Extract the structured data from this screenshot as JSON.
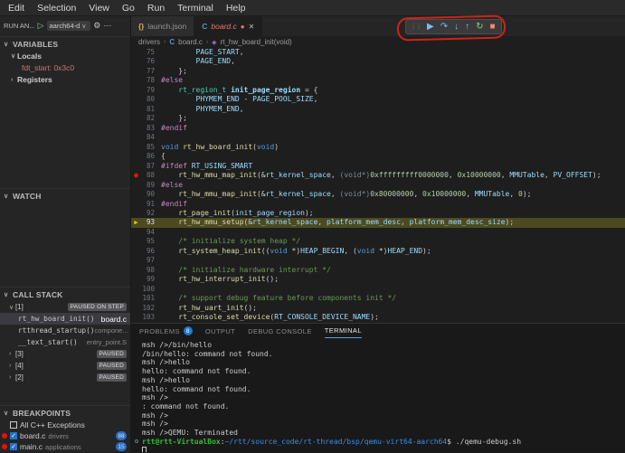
{
  "menu": {
    "items": [
      "Edit",
      "Selection",
      "View",
      "Go",
      "Run",
      "Terminal",
      "Help"
    ]
  },
  "colors": {
    "breakpoint_red": "#e51400",
    "current_line_arrow": "#ffcc00",
    "debug_icon_blue": "#75beff",
    "restart_green": "#89d185",
    "stop_red": "#f48771",
    "annotation_red": "#cc2418",
    "badge_blue": "#2e6fc0",
    "active_tab_file": "#e5796c"
  },
  "sidebar": {
    "run_header": {
      "label": "RUN AN...",
      "config_name": "aarch64-d",
      "chevron": "∨"
    },
    "variables": {
      "title": "VARIABLES",
      "locals_label": "Locals",
      "items": [
        {
          "name": "fdt_start",
          "value": "0x3c0"
        }
      ],
      "registers_label": "Registers"
    },
    "watch": {
      "title": "WATCH"
    },
    "call_stack": {
      "title": "CALL STACK",
      "threads": [
        {
          "label": "[1]",
          "badge": "PAUSED ON STEP",
          "expanded": true,
          "frames": [
            {
              "fn": "rt_hw_board_init()",
              "loc": "board.c",
              "selected": true
            },
            {
              "fn": "rtthread_startup()",
              "loc": "compone...",
              "selected": false
            },
            {
              "fn": "__text_start()",
              "loc": "entry_point.S",
              "selected": false
            }
          ]
        },
        {
          "label": "[3]",
          "badge": "PAUSED",
          "expanded": false,
          "frames": []
        },
        {
          "label": "[4]",
          "badge": "PAUSED",
          "expanded": false,
          "frames": []
        },
        {
          "label": "[2]",
          "badge": "PAUSED",
          "expanded": false,
          "frames": []
        }
      ]
    },
    "breakpoints": {
      "title": "BREAKPOINTS",
      "exceptions_label": "All C++ Exceptions",
      "items": [
        {
          "file": "board.c",
          "path": "drivers",
          "count": "88"
        },
        {
          "file": "main.c",
          "path": "applications",
          "count": "15"
        }
      ]
    }
  },
  "editor_tabs": [
    {
      "label": "launch.json",
      "icon": "braces",
      "active": false,
      "modified": false
    },
    {
      "label": "board.c",
      "icon": "c-file",
      "active": true,
      "modified": true
    }
  ],
  "debug_toolbar": {
    "buttons": [
      {
        "name": "continue-icon",
        "glyph": "▶",
        "color": "#75beff"
      },
      {
        "name": "step-over-icon",
        "glyph": "↷",
        "color": "#75beff"
      },
      {
        "name": "step-into-icon",
        "glyph": "↓",
        "color": "#75beff"
      },
      {
        "name": "step-out-icon",
        "glyph": "↑",
        "color": "#75beff"
      },
      {
        "name": "restart-icon",
        "glyph": "↻",
        "color": "#89d185"
      },
      {
        "name": "stop-icon",
        "glyph": "■",
        "color": "#f48771"
      }
    ]
  },
  "breadcrumb": {
    "items": [
      {
        "label": "drivers",
        "icon": ""
      },
      {
        "label": "board.c",
        "icon": "c-file"
      },
      {
        "label": "rt_hw_board_init(void)",
        "icon": "method"
      }
    ]
  },
  "editor": {
    "breakpoint_line": 88,
    "current_line": 93,
    "lines": [
      {
        "num": 75,
        "tokens": [
          {
            "c": "p",
            "t": "        "
          },
          {
            "c": "v",
            "t": "PAGE_START"
          },
          {
            "c": "p",
            "t": ","
          }
        ]
      },
      {
        "num": 76,
        "tokens": [
          {
            "c": "p",
            "t": "        "
          },
          {
            "c": "v",
            "t": "PAGE_END"
          },
          {
            "c": "p",
            "t": ","
          }
        ]
      },
      {
        "num": 77,
        "tokens": [
          {
            "c": "p",
            "t": "    };"
          }
        ]
      },
      {
        "num": 78,
        "tokens": [
          {
            "c": "d",
            "t": "#else"
          }
        ]
      },
      {
        "num": 79,
        "tokens": [
          {
            "c": "p",
            "t": "    "
          },
          {
            "c": "t",
            "t": "rt_region_t"
          },
          {
            "c": "p",
            "t": " "
          },
          {
            "c": "vb",
            "t": "init_page_region"
          },
          {
            "c": "p",
            "t": " = {"
          }
        ]
      },
      {
        "num": 80,
        "tokens": [
          {
            "c": "p",
            "t": "        "
          },
          {
            "c": "v",
            "t": "PHYMEM_END"
          },
          {
            "c": "p",
            "t": " - "
          },
          {
            "c": "v",
            "t": "PAGE_POOL_SIZE"
          },
          {
            "c": "p",
            "t": ","
          }
        ]
      },
      {
        "num": 81,
        "tokens": [
          {
            "c": "p",
            "t": "        "
          },
          {
            "c": "v",
            "t": "PHYMEM_END"
          },
          {
            "c": "p",
            "t": ","
          }
        ]
      },
      {
        "num": 82,
        "tokens": [
          {
            "c": "p",
            "t": "    };"
          }
        ]
      },
      {
        "num": 83,
        "tokens": [
          {
            "c": "d",
            "t": "#endif"
          }
        ]
      },
      {
        "num": 84,
        "tokens": []
      },
      {
        "num": 85,
        "tokens": [
          {
            "c": "k",
            "t": "void"
          },
          {
            "c": "p",
            "t": " "
          },
          {
            "c": "fn",
            "t": "rt_hw_board_init"
          },
          {
            "c": "p",
            "t": "("
          },
          {
            "c": "k",
            "t": "void"
          },
          {
            "c": "p",
            "t": ")"
          }
        ]
      },
      {
        "num": 86,
        "tokens": [
          {
            "c": "p",
            "t": "{"
          }
        ]
      },
      {
        "num": 87,
        "tokens": [
          {
            "c": "d",
            "t": "#ifdef "
          },
          {
            "c": "v",
            "t": "RT_USING_SMART"
          }
        ]
      },
      {
        "num": 88,
        "bp": true,
        "tokens": [
          {
            "c": "p",
            "t": "    "
          },
          {
            "c": "fn",
            "t": "rt_hw_mmu_map_init"
          },
          {
            "c": "p",
            "t": "(&"
          },
          {
            "c": "v",
            "t": "rt_kernel_space"
          },
          {
            "c": "p",
            "t": ", "
          },
          {
            "c": "dim",
            "t": "(void*)"
          },
          {
            "c": "n",
            "t": "0xfffffffff0000000"
          },
          {
            "c": "p",
            "t": ", "
          },
          {
            "c": "n",
            "t": "0x10000000"
          },
          {
            "c": "p",
            "t": ", "
          },
          {
            "c": "v",
            "t": "MMUTable"
          },
          {
            "c": "p",
            "t": ", "
          },
          {
            "c": "v",
            "t": "PV_OFFSET"
          },
          {
            "c": "p",
            "t": ");"
          }
        ]
      },
      {
        "num": 89,
        "tokens": [
          {
            "c": "d",
            "t": "#else"
          }
        ]
      },
      {
        "num": 90,
        "tokens": [
          {
            "c": "p",
            "t": "    "
          },
          {
            "c": "fn",
            "t": "rt_hw_mmu_map_init"
          },
          {
            "c": "p",
            "t": "(&"
          },
          {
            "c": "v",
            "t": "rt_kernel_space"
          },
          {
            "c": "p",
            "t": ", "
          },
          {
            "c": "dim",
            "t": "(void*)"
          },
          {
            "c": "n",
            "t": "0x80000000"
          },
          {
            "c": "p",
            "t": ", "
          },
          {
            "c": "n",
            "t": "0x10000000"
          },
          {
            "c": "p",
            "t": ", "
          },
          {
            "c": "v",
            "t": "MMUTable"
          },
          {
            "c": "p",
            "t": ", "
          },
          {
            "c": "n",
            "t": "0"
          },
          {
            "c": "p",
            "t": ");"
          }
        ]
      },
      {
        "num": 91,
        "tokens": [
          {
            "c": "d",
            "t": "#endif"
          }
        ]
      },
      {
        "num": 92,
        "tokens": [
          {
            "c": "p",
            "t": "    "
          },
          {
            "c": "fn",
            "t": "rt_page_init"
          },
          {
            "c": "p",
            "t": "("
          },
          {
            "c": "v",
            "t": "init_page_region"
          },
          {
            "c": "p",
            "t": ");"
          }
        ]
      },
      {
        "num": 93,
        "cur": true,
        "tokens": [
          {
            "c": "p",
            "t": "    "
          },
          {
            "c": "fn",
            "t": "rt_hw_mmu_setup"
          },
          {
            "c": "p",
            "t": "(&"
          },
          {
            "c": "v",
            "t": "rt_kernel_space"
          },
          {
            "c": "p",
            "t": ", "
          },
          {
            "c": "v",
            "t": "platform_mem_desc"
          },
          {
            "c": "p",
            "t": ", "
          },
          {
            "c": "v",
            "t": "platform_mem_desc_size"
          },
          {
            "c": "p",
            "t": ");"
          }
        ]
      },
      {
        "num": 94,
        "tokens": []
      },
      {
        "num": 95,
        "tokens": [
          {
            "c": "p",
            "t": "    "
          },
          {
            "c": "c",
            "t": "/* initialize system heap */"
          }
        ]
      },
      {
        "num": 96,
        "tokens": [
          {
            "c": "p",
            "t": "    "
          },
          {
            "c": "fn",
            "t": "rt_system_heap_init"
          },
          {
            "c": "p",
            "t": "(("
          },
          {
            "c": "k",
            "t": "void"
          },
          {
            "c": "p",
            "t": " *)"
          },
          {
            "c": "v",
            "t": "HEAP_BEGIN"
          },
          {
            "c": "p",
            "t": ", ("
          },
          {
            "c": "k",
            "t": "void"
          },
          {
            "c": "p",
            "t": " *)"
          },
          {
            "c": "v",
            "t": "HEAP_END"
          },
          {
            "c": "p",
            "t": ");"
          }
        ]
      },
      {
        "num": 97,
        "tokens": []
      },
      {
        "num": 98,
        "tokens": [
          {
            "c": "p",
            "t": "    "
          },
          {
            "c": "c",
            "t": "/* initialize hardware interrupt */"
          }
        ]
      },
      {
        "num": 99,
        "tokens": [
          {
            "c": "p",
            "t": "    "
          },
          {
            "c": "fn",
            "t": "rt_hw_interrupt_init"
          },
          {
            "c": "p",
            "t": "();"
          }
        ]
      },
      {
        "num": 100,
        "tokens": []
      },
      {
        "num": 101,
        "tokens": [
          {
            "c": "p",
            "t": "    "
          },
          {
            "c": "c",
            "t": "/* support debug feature before components init */"
          }
        ]
      },
      {
        "num": 102,
        "tokens": [
          {
            "c": "p",
            "t": "    "
          },
          {
            "c": "fn",
            "t": "rt_hw_uart_init"
          },
          {
            "c": "p",
            "t": "();"
          }
        ]
      },
      {
        "num": 103,
        "tokens": [
          {
            "c": "p",
            "t": "    "
          },
          {
            "c": "fn",
            "t": "rt_console_set_device"
          },
          {
            "c": "p",
            "t": "("
          },
          {
            "c": "v",
            "t": "RT_CONSOLE_DEVICE_NAME"
          },
          {
            "c": "p",
            "t": ");"
          }
        ]
      }
    ]
  },
  "panel": {
    "tabs": [
      {
        "label": "PROBLEMS",
        "badge": "8",
        "active": false
      },
      {
        "label": "OUTPUT",
        "active": false
      },
      {
        "label": "DEBUG CONSOLE",
        "active": false
      },
      {
        "label": "TERMINAL",
        "active": true
      }
    ],
    "terminal_lines": [
      {
        "segs": [
          {
            "c": "tp",
            "t": "msh />/bin/hello"
          }
        ]
      },
      {
        "segs": [
          {
            "c": "tp",
            "t": "/bin/hello: command not found."
          }
        ]
      },
      {
        "segs": [
          {
            "c": "tp",
            "t": "msh />hello"
          }
        ]
      },
      {
        "segs": [
          {
            "c": "tp",
            "t": "hello: command not found."
          }
        ]
      },
      {
        "segs": [
          {
            "c": "tp",
            "t": "msh />hello"
          }
        ]
      },
      {
        "segs": [
          {
            "c": "tp",
            "t": "hello: command not found."
          }
        ]
      },
      {
        "segs": [
          {
            "c": "tp",
            "t": "msh />"
          }
        ]
      },
      {
        "segs": [
          {
            "c": "tp",
            "t": ": command not found."
          }
        ]
      },
      {
        "segs": [
          {
            "c": "tp",
            "t": "msh />"
          }
        ]
      },
      {
        "segs": [
          {
            "c": "tp",
            "t": "msh />"
          }
        ]
      },
      {
        "segs": [
          {
            "c": "tp",
            "t": "msh />QEMU: Terminated"
          }
        ]
      },
      {
        "deco": true,
        "segs": [
          {
            "c": "tg",
            "t": "rtt@rtt-VirtualBox"
          },
          {
            "c": "tp",
            "t": ":"
          },
          {
            "c": "tb",
            "t": "~/rtt/source_code/rt-thread/bsp/qemu-virt64-aarch64"
          },
          {
            "c": "tp",
            "t": "$ ./qemu-debug.sh"
          }
        ]
      },
      {
        "cursor": true,
        "segs": []
      }
    ]
  }
}
